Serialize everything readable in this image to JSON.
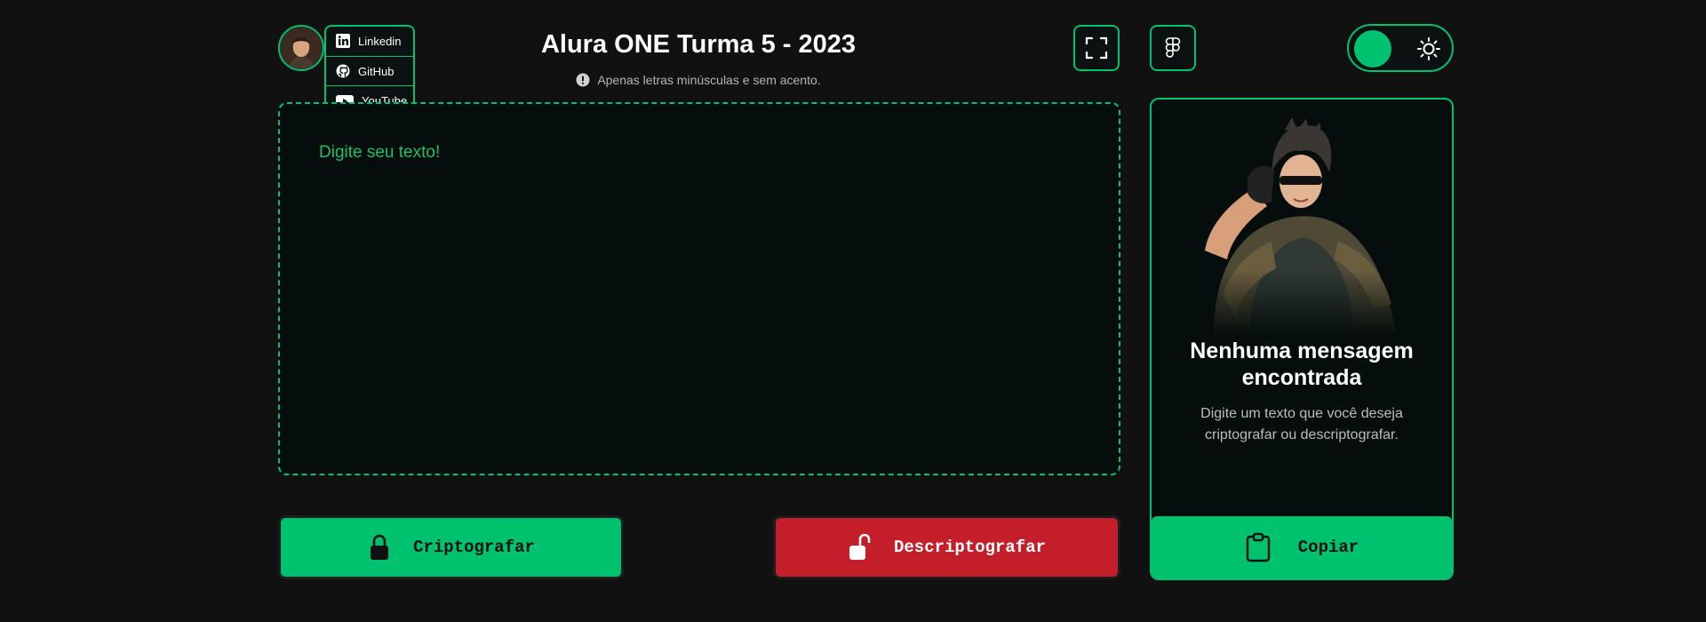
{
  "header": {
    "title": "Alura ONE Turma 5 - 2023",
    "hint": "Apenas letras minúsculas e sem acento.",
    "hint_icon": "alert-circle-icon"
  },
  "social": [
    {
      "label": "Linkedin",
      "icon": "linkedin-icon"
    },
    {
      "label": "GitHub",
      "icon": "github-icon"
    },
    {
      "label": "YouTube",
      "icon": "youtube-icon"
    }
  ],
  "toolbar": {
    "fullscreen_icon": "fullscreen-icon",
    "figma_icon": "figma-icon",
    "theme_icon": "sun-icon"
  },
  "editor": {
    "placeholder": "Digite seu texto!",
    "value": ""
  },
  "actions": {
    "encrypt_label": "Criptografar",
    "decrypt_label": "Descriptografar",
    "encrypt_icon": "lock-icon",
    "decrypt_icon": "unlock-icon"
  },
  "output": {
    "title": "Nenhuma mensagem encontrada",
    "text": "Digite um texto que você deseja criptografar ou descriptografar.",
    "copy_label": "Copiar",
    "copy_icon": "clipboard-icon"
  },
  "colors": {
    "accent": "#00c16e",
    "danger": "#c41e2b",
    "background": "#111111",
    "panel": "#060e0d"
  }
}
